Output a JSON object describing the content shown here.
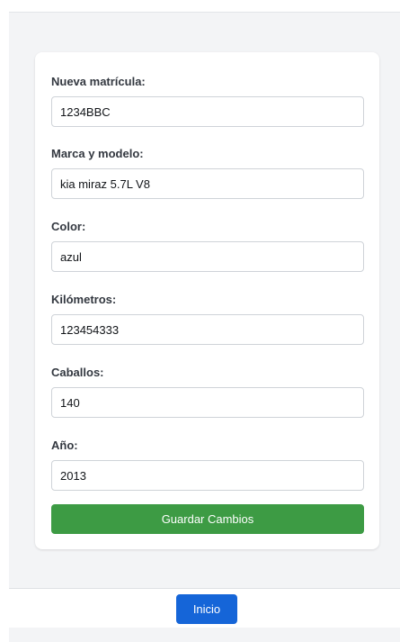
{
  "form": {
    "fields": [
      {
        "label": "Nueva matrícula:",
        "value": "1234BBC"
      },
      {
        "label": "Marca y modelo:",
        "value": "kia miraz 5.7L V8"
      },
      {
        "label": "Color:",
        "value": "azul"
      },
      {
        "label": "Kilómetros:",
        "value": "123454333"
      },
      {
        "label": "Caballos:",
        "value": "140"
      },
      {
        "label": "Año:",
        "value": "2013"
      }
    ],
    "save_label": "Guardar Cambios"
  },
  "footer": {
    "home_label": "Inicio"
  },
  "colors": {
    "save_button": "#3d9b44",
    "home_button": "#1565d8",
    "background": "#f3f4f6"
  }
}
